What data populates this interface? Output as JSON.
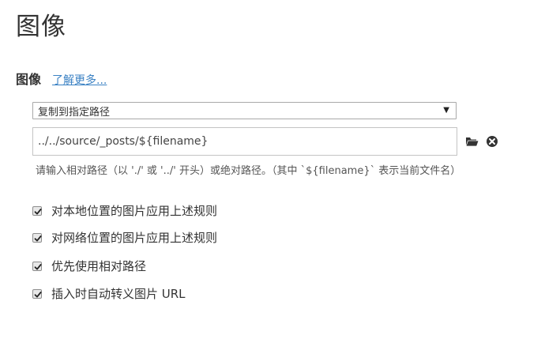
{
  "page": {
    "title": "图像"
  },
  "section": {
    "title": "图像",
    "learn_more": "了解更多..."
  },
  "select": {
    "value": "复制到指定路径"
  },
  "path_input": {
    "value": "../../source/_posts/${filename}"
  },
  "hint": {
    "text": "请输入相对路径（以 './' 或 '../' 开头）或绝对路径。（其中 `${filename}` 表示当前文件名）"
  },
  "options": [
    {
      "label": "对本地位置的图片应用上述规则",
      "checked": true
    },
    {
      "label": "对网络位置的图片应用上述规则",
      "checked": true
    },
    {
      "label": "优先使用相对路径",
      "checked": true
    },
    {
      "label": "插入时自动转义图片 URL",
      "checked": true
    }
  ],
  "icons": {
    "folder": "folder-open-icon",
    "clear": "clear-circle-icon"
  },
  "colors": {
    "link": "#3b82c4",
    "text": "#333333",
    "hint": "#555555"
  }
}
